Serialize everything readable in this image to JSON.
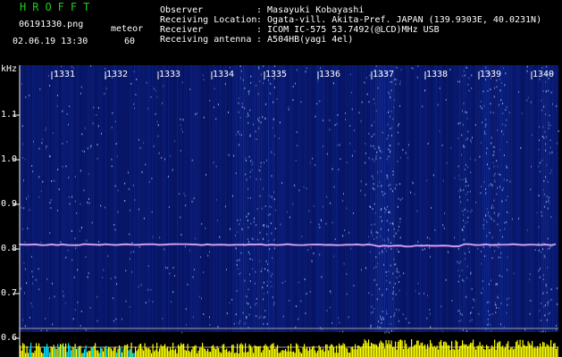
{
  "header": {
    "brand": "HROFFT",
    "filename": "06191330.png",
    "datetime": "02.06.19 13:30",
    "meteor_label": "meteor",
    "meteor_count": "60",
    "fields": [
      {
        "label": "Observer",
        "value": ": Masayuki Kobayashi"
      },
      {
        "label": "Receiving Location",
        "value": ": Ogata-vill. Akita-Pref. JAPAN (139.9303E, 40.0231N)"
      },
      {
        "label": "Receiver",
        "value": ": ICOM IC-575 53.7492(@LCD)MHz USB"
      },
      {
        "label": "Receiving antenna",
        "value": ": A504HB(yagi 4el)"
      }
    ]
  },
  "spectrogram": {
    "y_unit": "kHz",
    "y_ticks": [
      "1.1",
      "1.0",
      "0.9",
      "0.8",
      "0.7",
      "0.6"
    ],
    "x_ticks": [
      "1331",
      "1332",
      "1333",
      "1334",
      "1335",
      "1336",
      "1337",
      "1338",
      "1339",
      "1340"
    ],
    "carrier_khz": 0.81,
    "colors": {
      "background": "#000000",
      "noise_dark": "#05105a",
      "noise_light": "#9ec8ff",
      "carrier": "#c8b4ff",
      "activity_bars": "#ffff00",
      "activity_cyan": "#00e5ff"
    }
  }
}
